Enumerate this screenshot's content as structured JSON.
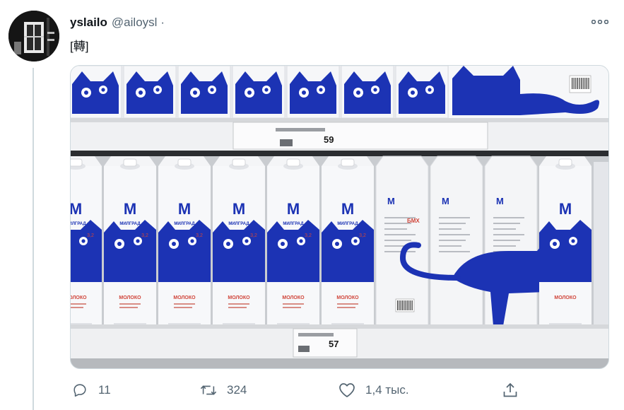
{
  "tweet": {
    "author_name": "yslailo",
    "author_handle": "@ailoysl",
    "separator": "·",
    "text": "[轉]"
  },
  "media": {
    "top_shelf_price": "59",
    "bottom_shelf_price": "57",
    "carton_brand": "МИЛГРАД",
    "carton_brand_letter": "М",
    "carton_fat": "3,2",
    "carton_product": "МОЛОКО",
    "carton_box_letters": "БМХ"
  },
  "actions": {
    "reply_count": "11",
    "retweet_count": "324",
    "like_count": "1,4 тыс.",
    "reply_icon": "reply-icon",
    "retweet_icon": "retweet-icon",
    "like_icon": "heart-icon",
    "share_icon": "share-icon"
  },
  "colors": {
    "carton_blue": "#1c33b4",
    "muted_text": "#536471",
    "divider": "#cfd9de"
  }
}
